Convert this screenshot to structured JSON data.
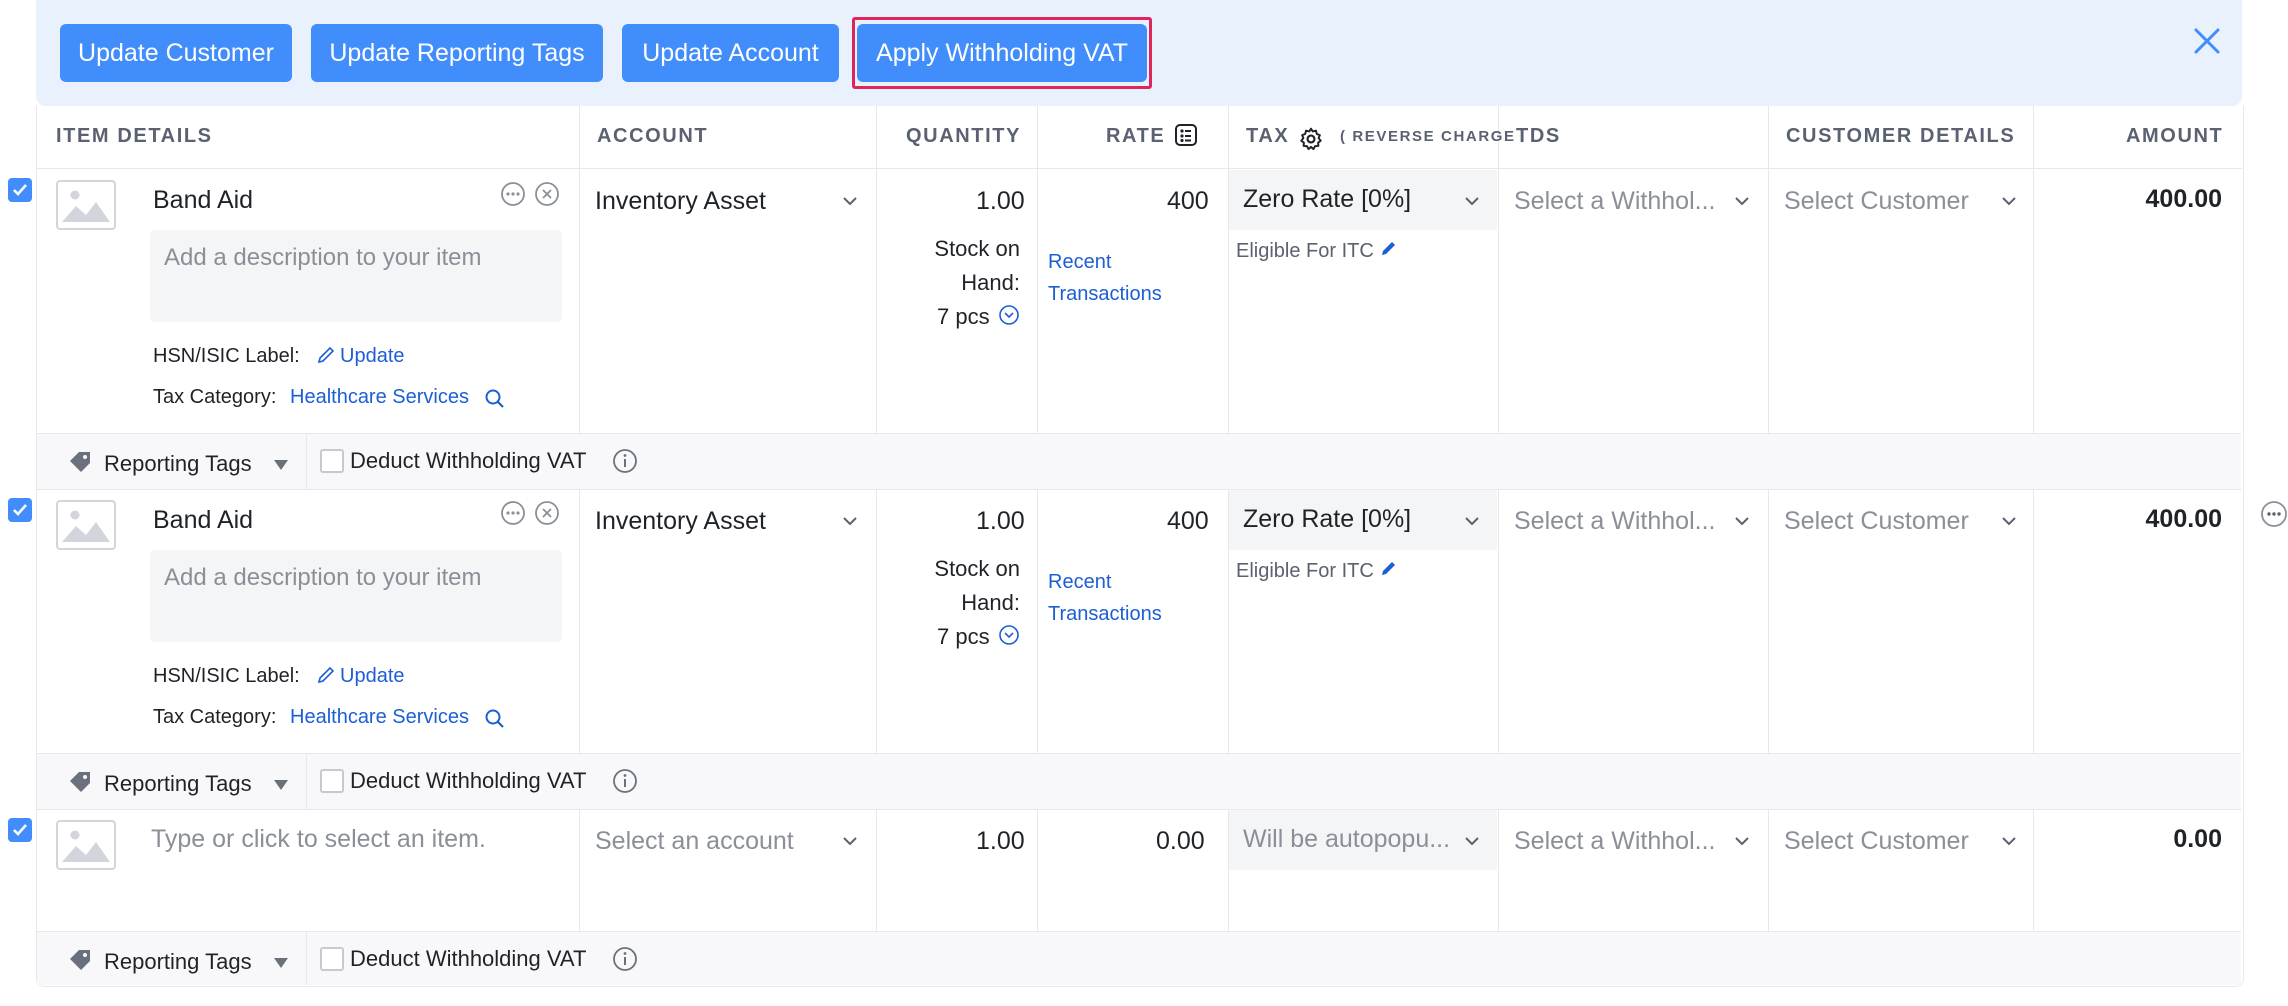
{
  "toolbar": {
    "buttons": [
      "Update Customer",
      "Update Reporting Tags",
      "Update Account",
      "Apply Withholding VAT"
    ]
  },
  "columns": {
    "item_details": "ITEM DETAILS",
    "account": "ACCOUNT",
    "quantity": "QUANTITY",
    "rate": "RATE",
    "tax": "TAX",
    "reverse_charge": "( REVERSE CHARGE",
    "tds": "TDS",
    "customer_details": "CUSTOMER DETAILS",
    "amount": "AMOUNT"
  },
  "rows": [
    {
      "item_name": "Band Aid",
      "description_placeholder": "Add a description to your item",
      "hsn_label": "HSN/ISIC Label:",
      "hsn_link": "Update",
      "tax_category_label": "Tax Category:",
      "tax_category_value": "Healthcare Services",
      "account": "Inventory Asset",
      "quantity": "1.00",
      "stock_line1": "Stock on",
      "stock_line2": "Hand:",
      "stock_line3": "7 pcs",
      "rate": "400",
      "recent_line1": "Recent",
      "recent_line2": "Transactions",
      "tax": "Zero Rate [0%]",
      "itc": "Eligible For ITC",
      "tds_placeholder": "Select a Withhol...",
      "customer_placeholder": "Select Customer",
      "amount": "400.00"
    },
    {
      "item_name": "Band Aid",
      "description_placeholder": "Add a description to your item",
      "hsn_label": "HSN/ISIC Label:",
      "hsn_link": "Update",
      "tax_category_label": "Tax Category:",
      "tax_category_value": "Healthcare Services",
      "account": "Inventory Asset",
      "quantity": "1.00",
      "stock_line1": "Stock on",
      "stock_line2": "Hand:",
      "stock_line3": "7 pcs",
      "rate": "400",
      "recent_line1": "Recent",
      "recent_line2": "Transactions",
      "tax": "Zero Rate [0%]",
      "itc": "Eligible For ITC",
      "tds_placeholder": "Select a Withhol...",
      "customer_placeholder": "Select Customer",
      "amount": "400.00"
    },
    {
      "item_placeholder": "Type or click to select an item.",
      "account_placeholder": "Select an account",
      "quantity": "1.00",
      "rate": "0.00",
      "tax_placeholder": "Will be autopopu...",
      "tds_placeholder": "Select a Withhol...",
      "customer_placeholder": "Select Customer",
      "amount": "0.00"
    }
  ],
  "row_footer": {
    "reporting_tags": "Reporting Tags",
    "deduct_withholding": "Deduct Withholding VAT"
  },
  "colors": {
    "accent": "#408dfb",
    "link": "#1c5fd4",
    "highlight_border": "#e0245e",
    "toolbar_bg": "#e9f1fd"
  },
  "icons": [
    "close-icon",
    "checkbox-checked-icon",
    "image-placeholder-icon",
    "more-icon",
    "remove-icon",
    "pencil-icon",
    "search-icon",
    "chevron-down-icon",
    "circle-chevron-down-icon",
    "calculator-icon",
    "gear-icon",
    "tag-icon",
    "caret-down-icon",
    "info-icon"
  ]
}
